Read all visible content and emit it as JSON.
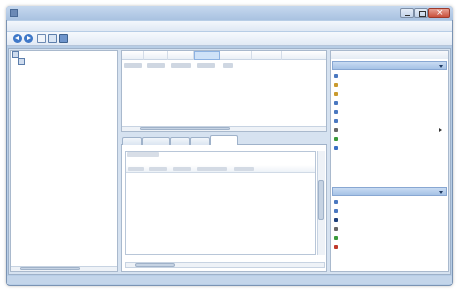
{
  "window": {
    "title": "",
    "menu": [
      "",
      "",
      "",
      ""
    ],
    "toolbar": [
      "back-icon",
      "forward-icon",
      "view-icon",
      "properties-icon",
      "help-icon"
    ]
  },
  "tree": [
    {
      "label": "",
      "icon": "computer-icon"
    },
    {
      "label": "",
      "icon": "folder-icon"
    }
  ],
  "top_grid": {
    "columns": [
      "",
      "",
      "",
      "",
      "",
      "",
      ""
    ],
    "rows": [
      [
        "",
        "",
        "",
        "",
        ""
      ]
    ]
  },
  "tabs": [
    "",
    "",
    "",
    "",
    ""
  ],
  "details": {
    "label": "",
    "columns": [
      "",
      "",
      "",
      "",
      ""
    ]
  },
  "actions": {
    "title": "",
    "sections": [
      {
        "label": "",
        "items": [
          {
            "label": "",
            "icon": "event-icon",
            "color": "#4a78c0",
            "submenu": false
          },
          {
            "label": "",
            "icon": "open-icon",
            "color": "#c99a2e",
            "submenu": false
          },
          {
            "label": "",
            "icon": "import-icon",
            "color": "#c99a2e",
            "submenu": false
          },
          {
            "label": "",
            "icon": "task-icon",
            "color": "#4a78c0",
            "submenu": false
          },
          {
            "label": "",
            "icon": "clear-icon",
            "color": "#4a78c0",
            "submenu": false
          },
          {
            "label": "",
            "icon": "filter-icon",
            "color": "#4a78c0",
            "submenu": false
          },
          {
            "label": "",
            "icon": "view-icon",
            "color": "#666666",
            "submenu": true
          },
          {
            "label": "",
            "icon": "refresh-icon",
            "color": "#3a9a3a",
            "submenu": false
          },
          {
            "label": "",
            "icon": "help-icon",
            "color": "#3a6fc4",
            "submenu": false
          }
        ]
      },
      {
        "label": "",
        "items": [
          {
            "label": "",
            "icon": "properties-icon",
            "color": "#4a78c0",
            "submenu": false
          },
          {
            "label": "",
            "icon": "copy-icon",
            "color": "#4a78c0",
            "submenu": false
          },
          {
            "label": "",
            "icon": "save-icon",
            "color": "#1e3f7a",
            "submenu": false
          },
          {
            "label": "",
            "icon": "export-icon",
            "color": "#666666",
            "submenu": false
          },
          {
            "label": "",
            "icon": "refresh-icon",
            "color": "#3a9a3a",
            "submenu": false
          },
          {
            "label": "",
            "icon": "delete-icon",
            "color": "#c0392b",
            "submenu": false
          }
        ]
      }
    ]
  }
}
